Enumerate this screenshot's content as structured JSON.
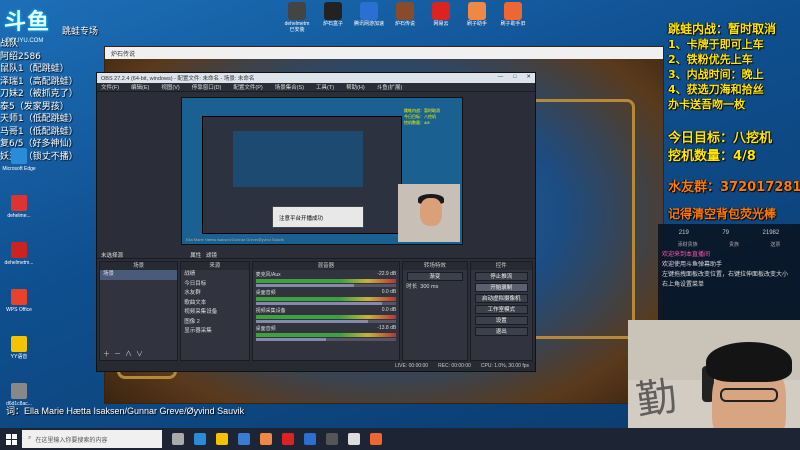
{
  "overlay_left": {
    "logo": "斗鱼",
    "logo_sub": "DOUYU.COM",
    "header": "跳蛙专场",
    "rows": [
      "战队",
      "阿绍2586",
      "鼠队1（配跳蛙）",
      "泽瑞1（高配跳蛙）",
      "刀妹2（被抓克了）",
      "泰5（发家男孩）",
      "天师1（低配跳蛙）",
      "马哥1（低配跳蛙）",
      "复6/5（好多神仙）",
      "妖王4（锁丈不播）"
    ]
  },
  "desktop_icons": [
    {
      "label": "Microsoft Edge",
      "icon": "edge-icon",
      "color": "#2a8bd8"
    },
    {
      "label": "dehelme...",
      "icon": "app-icon",
      "color": "#d33"
    },
    {
      "label": "dehelmetm...",
      "icon": "app-icon",
      "color": "#c22"
    },
    {
      "label": "WPS Office",
      "icon": "wps-icon",
      "color": "#e8412c"
    },
    {
      "label": "YY语音",
      "icon": "yy-icon",
      "color": "#f5c400"
    },
    {
      "label": "d6d1c8ac...",
      "icon": "file-icon",
      "color": "#888"
    }
  ],
  "top_icons": [
    {
      "label": "dehelmetm 已安装",
      "color": "#444"
    },
    {
      "label": "炉石盒子",
      "color": "#222"
    },
    {
      "label": "腾讯网游加速",
      "color": "#2a6fd1"
    },
    {
      "label": "炉石传说",
      "color": "#8a4b2c"
    },
    {
      "label": "网易云",
      "color": "#d22"
    },
    {
      "label": "刷子助手",
      "color": "#e84"
    },
    {
      "label": "刷子助手旧",
      "color": "#e63"
    }
  ],
  "overlay_right": {
    "title": "跳蛙内战：暂时取消",
    "rules": [
      "1、卡牌于即可上车",
      "2、铁粉优先上车",
      "3、内战时间：晚上",
      "4、获选刀海和拾丝"
    ],
    "extra": "办卡送吾吻一枚",
    "goal": "今日目标：八挖机",
    "count": "挖机数量：4/8",
    "qq_group": "水友群：372017281",
    "reminder": "记得清空背包荧光棒"
  },
  "game_window": {
    "title": "炉石传说"
  },
  "obs": {
    "title": "OBS 27.2.4 (64-bit, windows) - 配置文件: 未命名 - 场景: 未命名",
    "window_controls": [
      "—",
      "□",
      "✕"
    ],
    "menu": [
      "文件(F)",
      "编辑(E)",
      "视图(V)",
      "停靠窗口(D)",
      "配置文件(P)",
      "场景集合(S)",
      "工具(T)",
      "帮助(H)",
      "斗鱼(扩展)"
    ],
    "preview_dialog": "注意平台开播成功",
    "preview_caption": "Ella Marie Hætta Isaksen/Gunnar Greve/Øyvind Sauvik",
    "control_strip": [
      "未选择源",
      "属性",
      "滤镜"
    ],
    "scenes_header": "场景",
    "scenes": [
      "场景"
    ],
    "sources_header": "来源",
    "sources": [
      "战绩",
      "今日目标",
      "水友群",
      "歌曲文本",
      "视频采集设备",
      "图像 2",
      "显示器采集"
    ],
    "mixer_header": "混音器",
    "mixer": [
      {
        "name": "麦克风/Aux",
        "db": "-22.9 dB",
        "level": 0.7
      },
      {
        "name": "桌面音频",
        "db": "0.0 dB",
        "level": 0.9
      },
      {
        "name": "视频采集设备",
        "db": "0.0 dB",
        "level": 0.8
      },
      {
        "name": "桌面音频",
        "db": "-13.8 dB",
        "level": 0.5
      }
    ],
    "transitions_header": "转场特效",
    "transition_type": "渐变",
    "transition_duration_label": "时长",
    "transition_duration": "300 ms",
    "controls_header": "控件",
    "controls": [
      "停止推流",
      "开始录制",
      "启动虚拟摄像机",
      "工作室模式",
      "设置",
      "退出"
    ],
    "status": [
      "LIVE: 00:00:00",
      "REC: 00:00:00",
      "CPU: 1.0%, 30.00 fps"
    ]
  },
  "chat": {
    "stats": [
      "219",
      "79",
      "21982"
    ],
    "users": [
      "添财贵族",
      "贵族",
      "送票"
    ],
    "messages": [
      "欢迎来到本直播间",
      "欢迎使用斗鱼弹幕助手",
      "左键拖拽面板改变位置，右键拉伸面板改变大小",
      "右上角设置菜单"
    ]
  },
  "song_line": "词：Ella Marie Hætta Isaksen/Gunnar Greve/Øyvind Sauvik",
  "taskbar": {
    "search_placeholder": "在这里输入你要搜索的内容",
    "icons": [
      "#2a8bd8",
      "#f5c400",
      "#3b7bd4",
      "#e84",
      "#d22",
      "#2a6fd1",
      "#555",
      "#ddd",
      "#e63"
    ]
  }
}
